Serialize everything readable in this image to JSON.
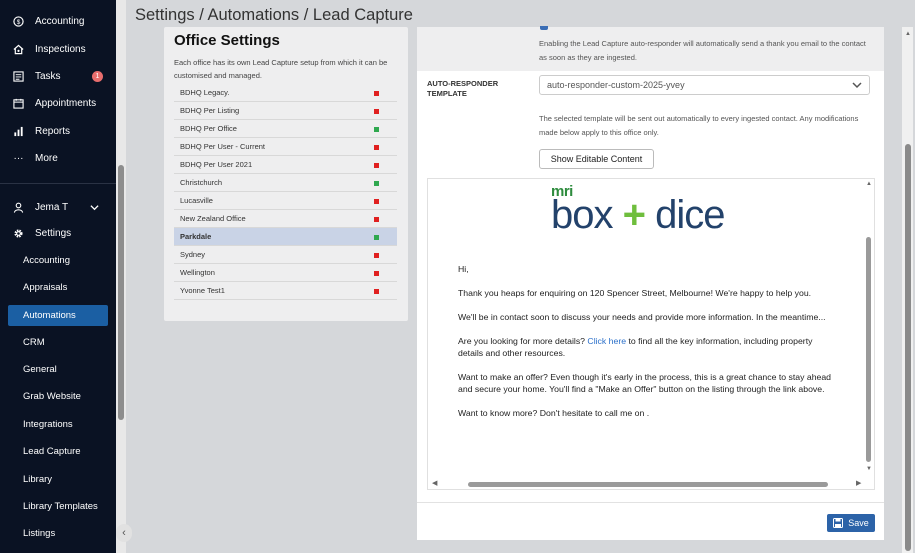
{
  "sidebar": {
    "items": [
      {
        "label": "Accounting",
        "icon": "dollar-circle-icon"
      },
      {
        "label": "Inspections",
        "icon": "house-icon"
      },
      {
        "label": "Tasks",
        "icon": "checklist-icon",
        "badge": "1"
      },
      {
        "label": "Appointments",
        "icon": "calendar-icon"
      },
      {
        "label": "Reports",
        "icon": "bar-chart-icon"
      },
      {
        "label": "More",
        "icon": "ellipsis-icon"
      }
    ],
    "user": {
      "name": "Jema T"
    },
    "settings_label": "Settings",
    "settings_items": [
      "Accounting",
      "Appraisals",
      "Automations",
      "CRM",
      "General",
      "Grab Website",
      "Integrations",
      "Lead Capture",
      "Library",
      "Library Templates",
      "Listings"
    ],
    "active_settings_item": "Automations"
  },
  "header": {
    "breadcrumb": "Settings / Automations / Lead Capture"
  },
  "office_settings": {
    "title": "Office Settings",
    "description": "Each office has its own Lead Capture setup from which it can be customised and managed.",
    "offices": [
      {
        "name": "BDHQ Legacy.",
        "status": "red"
      },
      {
        "name": "BDHQ Per Listing",
        "status": "red"
      },
      {
        "name": "BDHQ Per Office",
        "status": "green"
      },
      {
        "name": "BDHQ Per User - Current",
        "status": "red"
      },
      {
        "name": "BDHQ Per User 2021",
        "status": "red"
      },
      {
        "name": "Christchurch",
        "status": "green"
      },
      {
        "name": "Lucasville",
        "status": "red"
      },
      {
        "name": "New Zealand Office",
        "status": "red"
      },
      {
        "name": "Parkdale",
        "status": "green",
        "selected": true
      },
      {
        "name": "Sydney",
        "status": "red"
      },
      {
        "name": "Wellington",
        "status": "red"
      },
      {
        "name": "Yvonne Test1",
        "status": "red"
      }
    ],
    "status_colors": {
      "red": "#e02020",
      "green": "#2fa84f"
    }
  },
  "autoresponder": {
    "enable_text": "Enabling the Lead Capture auto-responder will automatically send a thank you email to the contact as soon as they are ingested.",
    "template_label": "AUTO-RESPONDER TEMPLATE",
    "template_value": "auto-responder-custom-2025-yvey",
    "template_help": "The selected template will be sent out automatically to every ingested contact. Any modifications made below apply to this office only.",
    "show_editable_label": "Show Editable Content",
    "save_label": "Save"
  },
  "email": {
    "logo_small": "mri",
    "logo_left": "box",
    "logo_plus": "+",
    "logo_right": "dice",
    "greeting": "Hi,",
    "p1": "Thank you heaps for enquiring on 120 Spencer Street, Melbourne! We're happy to help you.",
    "p2": "We'll be in contact soon to discuss your needs and provide more information. In the meantime...",
    "p3_before": "Are you looking for more details? ",
    "p3_link": "Click here",
    "p3_after": " to find all the key information, including property details and other resources.",
    "p4": "Want to make an offer? Even though it's early in the process, this is a great chance to stay ahead and secure your home. You'll find a \"Make an Offer\" button on the listing through the link above.",
    "p5": "Want to know more? Don't hesitate to call me on ."
  }
}
